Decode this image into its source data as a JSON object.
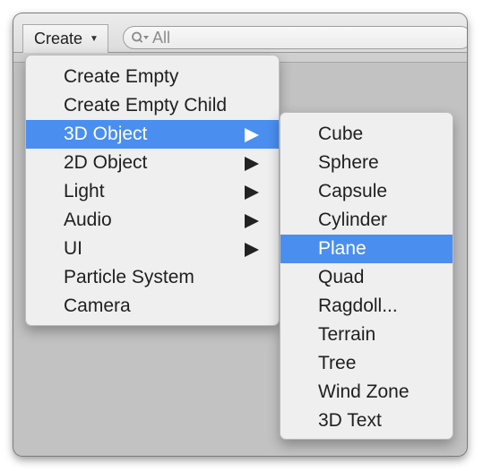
{
  "toolbar": {
    "create_label": "Create",
    "search_placeholder": "All",
    "search_icon": "search-icon"
  },
  "main_menu": {
    "items": [
      {
        "label": "Create Empty",
        "has_submenu": false
      },
      {
        "label": "Create Empty Child",
        "has_submenu": false
      },
      {
        "label": "3D Object",
        "has_submenu": true,
        "highlighted": true
      },
      {
        "label": "2D Object",
        "has_submenu": true
      },
      {
        "label": "Light",
        "has_submenu": true
      },
      {
        "label": "Audio",
        "has_submenu": true
      },
      {
        "label": "UI",
        "has_submenu": true
      },
      {
        "label": "Particle System",
        "has_submenu": false
      },
      {
        "label": "Camera",
        "has_submenu": false
      }
    ]
  },
  "submenu_3d": {
    "items": [
      {
        "label": "Cube"
      },
      {
        "label": "Sphere"
      },
      {
        "label": "Capsule"
      },
      {
        "label": "Cylinder"
      },
      {
        "label": "Plane",
        "highlighted": true
      },
      {
        "label": "Quad"
      },
      {
        "label": "Ragdoll..."
      },
      {
        "label": "Terrain"
      },
      {
        "label": "Tree"
      },
      {
        "label": "Wind Zone"
      },
      {
        "label": "3D Text"
      }
    ]
  },
  "colors": {
    "highlight": "#4a8ef0",
    "menu_background": "#efefef",
    "window_background": "#c2c2c2"
  }
}
